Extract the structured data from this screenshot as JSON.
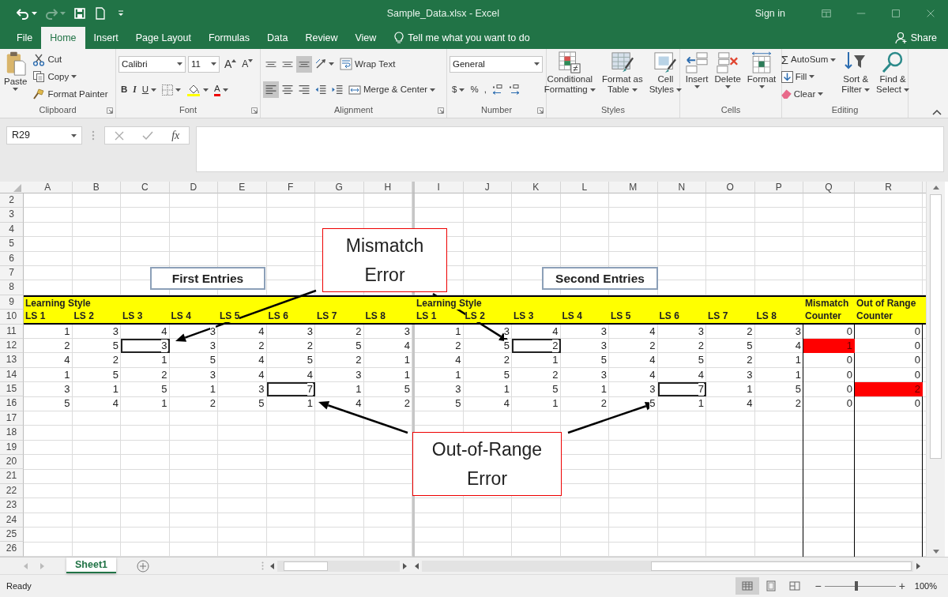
{
  "title_bar": {
    "quick_access": [
      {
        "kind": "undo",
        "disabled": false,
        "menu": true
      },
      {
        "kind": "redo",
        "disabled": true,
        "menu": true
      },
      {
        "kind": "save",
        "disabled": false,
        "menu": false
      },
      {
        "kind": "new",
        "disabled": false,
        "menu": false
      },
      {
        "kind": "customize",
        "disabled": false,
        "menu": false
      }
    ],
    "title": "Sample_Data.xlsx - Excel",
    "sign_in": "Sign in"
  },
  "menu_tabs": [
    {
      "label": "File",
      "selected": false
    },
    {
      "label": "Home",
      "selected": true
    },
    {
      "label": "Insert",
      "selected": false
    },
    {
      "label": "Page Layout",
      "selected": false
    },
    {
      "label": "Formulas",
      "selected": false
    },
    {
      "label": "Data",
      "selected": false
    },
    {
      "label": "Review",
      "selected": false
    },
    {
      "label": "View",
      "selected": false
    }
  ],
  "tell_me": "Tell me what you want to do",
  "share": "Share",
  "ribbon": {
    "groups": [
      {
        "name": "Clipboard",
        "launcher": true,
        "sections": [
          {
            "kind": "large",
            "items": [
              {
                "kind": "paste",
                "lines": [
                  "Paste"
                ],
                "menu": true
              }
            ]
          },
          {
            "kind": "stack",
            "rows": [
              {
                "items": [
                  {
                    "kind": "cut",
                    "label": "Cut",
                    "menu": false
                  }
                ]
              },
              {
                "items": [
                  {
                    "kind": "copy",
                    "label": "Copy",
                    "menu": true
                  }
                ]
              },
              {
                "items": [
                  {
                    "kind": "painter",
                    "label": "Format Painter",
                    "menu": false
                  }
                ]
              }
            ]
          }
        ]
      },
      {
        "name": "Font",
        "launcher": true,
        "sections": [
          {
            "kind": "stack",
            "rows": [
              {
                "items": [
                  {
                    "kind": "field",
                    "value": "Calibri",
                    "menu": true
                  },
                  {
                    "kind": "field",
                    "value": "11",
                    "menu": true
                  },
                  {
                    "kind": "grow",
                    "label": "A",
                    "menu": false
                  },
                  {
                    "kind": "shrink",
                    "label": "A",
                    "menu": false
                  }
                ]
              },
              {
                "items": [
                  {
                    "kind": "bold",
                    "label": "B",
                    "menu": false
                  },
                  {
                    "kind": "italic",
                    "label": "I",
                    "menu": false
                  },
                  {
                    "kind": "underline",
                    "label": "U",
                    "menu": true
                  },
                  {
                    "kind": "border",
                    "menu": true
                  },
                  {
                    "kind": "fill",
                    "menu": true
                  },
                  {
                    "kind": "fontcolor",
                    "label": "A",
                    "menu": true
                  }
                ]
              }
            ]
          }
        ]
      },
      {
        "name": "Alignment",
        "launcher": true,
        "sections": [
          {
            "kind": "stack",
            "rows": [
              {
                "items": [
                  {
                    "kind": "aligntop",
                    "menu": false,
                    "pressed": false
                  },
                  {
                    "kind": "alignmiddle",
                    "menu": false,
                    "pressed": false
                  },
                  {
                    "kind": "alignbottom",
                    "menu": false,
                    "pressed": true
                  },
                  {
                    "kind": "orientation",
                    "menu": true,
                    "pressed": false
                  },
                  {
                    "kind": "wrap",
                    "label": "Wrap Text",
                    "menu": false,
                    "pressed": false
                  }
                ]
              },
              {
                "items": [
                  {
                    "kind": "alignleft",
                    "menu": false,
                    "pressed": true
                  },
                  {
                    "kind": "aligncenter",
                    "menu": false,
                    "pressed": false
                  },
                  {
                    "kind": "alignright",
                    "menu": false,
                    "pressed": false
                  },
                  {
                    "kind": "outdent",
                    "menu": false,
                    "pressed": false
                  },
                  {
                    "kind": "indent",
                    "menu": false,
                    "pressed": false
                  },
                  {
                    "kind": "merge",
                    "label": "Merge & Center",
                    "menu": true,
                    "pressed": false
                  }
                ]
              }
            ]
          }
        ]
      },
      {
        "name": "Number",
        "launcher": true,
        "sections": [
          {
            "kind": "stack",
            "rows": [
              {
                "items": [
                  {
                    "kind": "field",
                    "value": "General",
                    "menu": true
                  }
                ]
              },
              {
                "items": [
                  {
                    "kind": "currency",
                    "label": "$",
                    "menu": true
                  },
                  {
                    "kind": "percent",
                    "label": "%",
                    "menu": false
                  },
                  {
                    "kind": "comma",
                    "label": ",",
                    "menu": false
                  },
                  {
                    "kind": "decinc",
                    "menu": false
                  },
                  {
                    "kind": "decdec",
                    "menu": false
                  }
                ]
              }
            ]
          }
        ]
      },
      {
        "name": "Styles",
        "launcher": false,
        "sections": [
          {
            "kind": "large",
            "items": [
              {
                "kind": "condformat",
                "lines": [
                  "Conditional",
                  "Formatting"
                ],
                "menu": true
              },
              {
                "kind": "tableformat",
                "lines": [
                  "Format as",
                  "Table"
                ],
                "menu": true
              },
              {
                "kind": "cellstyles",
                "lines": [
                  "Cell",
                  "Styles"
                ],
                "menu": true
              }
            ]
          }
        ]
      },
      {
        "name": "Cells",
        "launcher": false,
        "sections": [
          {
            "kind": "large",
            "items": [
              {
                "kind": "insert",
                "lines": [
                  "Insert"
                ],
                "menu": true
              },
              {
                "kind": "delete",
                "lines": [
                  "Delete"
                ],
                "menu": true
              },
              {
                "kind": "format",
                "lines": [
                  "Format"
                ],
                "menu": true
              }
            ]
          }
        ]
      },
      {
        "name": "Editing",
        "launcher": false,
        "sections": [
          {
            "kind": "stack",
            "rows": [
              {
                "items": [
                  {
                    "kind": "autosum",
                    "symbol": "Σ",
                    "label": "AutoSum",
                    "menu": true
                  }
                ]
              },
              {
                "items": [
                  {
                    "kind": "filldown",
                    "label": "Fill",
                    "menu": true
                  }
                ]
              },
              {
                "items": [
                  {
                    "kind": "clear",
                    "label": "Clear",
                    "menu": true
                  }
                ]
              }
            ]
          },
          {
            "kind": "large",
            "items": [
              {
                "kind": "sort",
                "lines": [
                  "Sort &",
                  "Filter"
                ],
                "menu": true
              },
              {
                "kind": "find",
                "lines": [
                  "Find &",
                  "Select"
                ],
                "menu": true
              }
            ]
          }
        ]
      }
    ]
  },
  "formula_bar": {
    "name_box": "R29",
    "function_label": "fx"
  },
  "sheet": {
    "columns": [
      "A",
      "B",
      "C",
      "D",
      "E",
      "F",
      "G",
      "H",
      "I",
      "J",
      "K",
      "L",
      "M",
      "N",
      "O",
      "P",
      "Q",
      "R"
    ],
    "rows": [
      {
        "number": "2",
        "kind": "empty"
      },
      {
        "number": "3",
        "kind": "empty"
      },
      {
        "number": "4",
        "kind": "empty"
      },
      {
        "number": "5",
        "kind": "empty"
      },
      {
        "number": "6",
        "kind": "empty"
      },
      {
        "number": "7",
        "kind": "empty"
      },
      {
        "number": "8",
        "kind": "empty"
      },
      {
        "number": "9",
        "kind": "header",
        "cells": [
          {
            "kind": "header",
            "value": "Learning Style"
          },
          {
            "kind": "blank"
          },
          {
            "kind": "blank"
          },
          {
            "kind": "blank"
          },
          {
            "kind": "blank"
          },
          {
            "kind": "blank"
          },
          {
            "kind": "blank"
          },
          {
            "kind": "blank"
          },
          {
            "kind": "header",
            "value": "Learning Style"
          },
          {
            "kind": "blank"
          },
          {
            "kind": "blank"
          },
          {
            "kind": "blank"
          },
          {
            "kind": "blank"
          },
          {
            "kind": "blank"
          },
          {
            "kind": "blank"
          },
          {
            "kind": "blank"
          },
          {
            "kind": "header",
            "value": "Mismatch"
          },
          {
            "kind": "header",
            "value": "Out of Range"
          }
        ]
      },
      {
        "number": "10",
        "kind": "header",
        "cells": [
          {
            "kind": "header",
            "value": "LS 1"
          },
          {
            "kind": "header",
            "value": "LS 2"
          },
          {
            "kind": "header",
            "value": "LS 3"
          },
          {
            "kind": "header",
            "value": "LS 4"
          },
          {
            "kind": "header",
            "value": "LS 5"
          },
          {
            "kind": "header",
            "value": "LS 6"
          },
          {
            "kind": "header",
            "value": "LS 7"
          },
          {
            "kind": "header",
            "value": "LS 8"
          },
          {
            "kind": "header",
            "value": "LS 1"
          },
          {
            "kind": "header",
            "value": "LS 2"
          },
          {
            "kind": "header",
            "value": "LS 3"
          },
          {
            "kind": "header",
            "value": "LS 4"
          },
          {
            "kind": "header",
            "value": "LS 5"
          },
          {
            "kind": "header",
            "value": "LS 6"
          },
          {
            "kind": "header",
            "value": "LS 7"
          },
          {
            "kind": "header",
            "value": "LS 8"
          },
          {
            "kind": "header",
            "value": "Counter"
          },
          {
            "kind": "header",
            "value": "Counter"
          }
        ]
      },
      {
        "number": "11",
        "kind": "data",
        "cells": [
          {
            "kind": "number",
            "value": "1"
          },
          {
            "kind": "number",
            "value": "3"
          },
          {
            "kind": "number",
            "value": "4"
          },
          {
            "kind": "number",
            "value": "3"
          },
          {
            "kind": "number",
            "value": "4"
          },
          {
            "kind": "number",
            "value": "3"
          },
          {
            "kind": "number",
            "value": "2"
          },
          {
            "kind": "number",
            "value": "3"
          },
          {
            "kind": "number",
            "value": "1"
          },
          {
            "kind": "number",
            "value": "3"
          },
          {
            "kind": "number",
            "value": "4"
          },
          {
            "kind": "number",
            "value": "3"
          },
          {
            "kind": "number",
            "value": "4"
          },
          {
            "kind": "number",
            "value": "3"
          },
          {
            "kind": "number",
            "value": "2"
          },
          {
            "kind": "number",
            "value": "3"
          },
          {
            "kind": "number",
            "value": "0"
          },
          {
            "kind": "number",
            "value": "0"
          }
        ]
      },
      {
        "number": "12",
        "kind": "data",
        "cells": [
          {
            "kind": "number",
            "value": "2"
          },
          {
            "kind": "number",
            "value": "5"
          },
          {
            "kind": "outlined",
            "value": "3"
          },
          {
            "kind": "number",
            "value": "3"
          },
          {
            "kind": "number",
            "value": "2"
          },
          {
            "kind": "number",
            "value": "2"
          },
          {
            "kind": "number",
            "value": "5"
          },
          {
            "kind": "number",
            "value": "4"
          },
          {
            "kind": "number",
            "value": "2"
          },
          {
            "kind": "number",
            "value": "5"
          },
          {
            "kind": "outlined",
            "value": "2"
          },
          {
            "kind": "number",
            "value": "3"
          },
          {
            "kind": "number",
            "value": "2"
          },
          {
            "kind": "number",
            "value": "2"
          },
          {
            "kind": "number",
            "value": "5"
          },
          {
            "kind": "number",
            "value": "4"
          },
          {
            "kind": "flagged",
            "value": "1"
          },
          {
            "kind": "number",
            "value": "0"
          }
        ]
      },
      {
        "number": "13",
        "kind": "data",
        "cells": [
          {
            "kind": "number",
            "value": "4"
          },
          {
            "kind": "number",
            "value": "2"
          },
          {
            "kind": "number",
            "value": "1"
          },
          {
            "kind": "number",
            "value": "5"
          },
          {
            "kind": "number",
            "value": "4"
          },
          {
            "kind": "number",
            "value": "5"
          },
          {
            "kind": "number",
            "value": "2"
          },
          {
            "kind": "number",
            "value": "1"
          },
          {
            "kind": "number",
            "value": "4"
          },
          {
            "kind": "number",
            "value": "2"
          },
          {
            "kind": "number",
            "value": "1"
          },
          {
            "kind": "number",
            "value": "5"
          },
          {
            "kind": "number",
            "value": "4"
          },
          {
            "kind": "number",
            "value": "5"
          },
          {
            "kind": "number",
            "value": "2"
          },
          {
            "kind": "number",
            "value": "1"
          },
          {
            "kind": "number",
            "value": "0"
          },
          {
            "kind": "number",
            "value": "0"
          }
        ]
      },
      {
        "number": "14",
        "kind": "data",
        "cells": [
          {
            "kind": "number",
            "value": "1"
          },
          {
            "kind": "number",
            "value": "5"
          },
          {
            "kind": "number",
            "value": "2"
          },
          {
            "kind": "number",
            "value": "3"
          },
          {
            "kind": "number",
            "value": "4"
          },
          {
            "kind": "number",
            "value": "4"
          },
          {
            "kind": "number",
            "value": "3"
          },
          {
            "kind": "number",
            "value": "1"
          },
          {
            "kind": "number",
            "value": "1"
          },
          {
            "kind": "number",
            "value": "5"
          },
          {
            "kind": "number",
            "value": "2"
          },
          {
            "kind": "number",
            "value": "3"
          },
          {
            "kind": "number",
            "value": "4"
          },
          {
            "kind": "number",
            "value": "4"
          },
          {
            "kind": "number",
            "value": "3"
          },
          {
            "kind": "number",
            "value": "1"
          },
          {
            "kind": "number",
            "value": "0"
          },
          {
            "kind": "number",
            "value": "0"
          }
        ]
      },
      {
        "number": "15",
        "kind": "data",
        "cells": [
          {
            "kind": "number",
            "value": "3"
          },
          {
            "kind": "number",
            "value": "1"
          },
          {
            "kind": "number",
            "value": "5"
          },
          {
            "kind": "number",
            "value": "1"
          },
          {
            "kind": "number",
            "value": "3"
          },
          {
            "kind": "outlined",
            "value": "7"
          },
          {
            "kind": "number",
            "value": "1"
          },
          {
            "kind": "number",
            "value": "5"
          },
          {
            "kind": "number",
            "value": "3"
          },
          {
            "kind": "number",
            "value": "1"
          },
          {
            "kind": "number",
            "value": "5"
          },
          {
            "kind": "number",
            "value": "1"
          },
          {
            "kind": "number",
            "value": "3"
          },
          {
            "kind": "outlined",
            "value": "7"
          },
          {
            "kind": "number",
            "value": "1"
          },
          {
            "kind": "number",
            "value": "5"
          },
          {
            "kind": "number",
            "value": "0"
          },
          {
            "kind": "flagged",
            "value": "2"
          }
        ]
      },
      {
        "number": "16",
        "kind": "data",
        "cells": [
          {
            "kind": "number",
            "value": "5"
          },
          {
            "kind": "number",
            "value": "4"
          },
          {
            "kind": "number",
            "value": "1"
          },
          {
            "kind": "number",
            "value": "2"
          },
          {
            "kind": "number",
            "value": "5"
          },
          {
            "kind": "number",
            "value": "1"
          },
          {
            "kind": "number",
            "value": "4"
          },
          {
            "kind": "number",
            "value": "2"
          },
          {
            "kind": "number",
            "value": "5"
          },
          {
            "kind": "number",
            "value": "4"
          },
          {
            "kind": "number",
            "value": "1"
          },
          {
            "kind": "number",
            "value": "2"
          },
          {
            "kind": "number",
            "value": "5"
          },
          {
            "kind": "number",
            "value": "1"
          },
          {
            "kind": "number",
            "value": "4"
          },
          {
            "kind": "number",
            "value": "2"
          },
          {
            "kind": "number",
            "value": "0"
          },
          {
            "kind": "number",
            "value": "0"
          }
        ]
      },
      {
        "number": "17",
        "kind": "empty"
      },
      {
        "number": "18",
        "kind": "empty"
      },
      {
        "number": "19",
        "kind": "empty"
      },
      {
        "number": "20",
        "kind": "empty"
      },
      {
        "number": "21",
        "kind": "empty"
      },
      {
        "number": "22",
        "kind": "empty"
      },
      {
        "number": "23",
        "kind": "empty"
      },
      {
        "number": "24",
        "kind": "empty"
      },
      {
        "number": "25",
        "kind": "empty"
      },
      {
        "number": "26",
        "kind": "empty"
      }
    ]
  },
  "callouts": [
    {
      "kind": "label",
      "text": "First Entries"
    },
    {
      "kind": "error",
      "text": "Mismatch Error"
    },
    {
      "kind": "label",
      "text": "Second Entries"
    },
    {
      "kind": "error",
      "text": "Out-of-Range Error"
    }
  ],
  "sheet_tabs": [
    {
      "label": "Sheet1",
      "selected": true
    }
  ],
  "status_bar": {
    "text": "Ready",
    "views": [
      {
        "kind": "normal",
        "selected": true
      },
      {
        "kind": "pagelayout",
        "selected": false
      },
      {
        "kind": "pagebreak",
        "selected": false
      }
    ],
    "zoom": {
      "minus": "−",
      "plus": "+",
      "level": 0.45,
      "reading": "100%"
    }
  }
}
